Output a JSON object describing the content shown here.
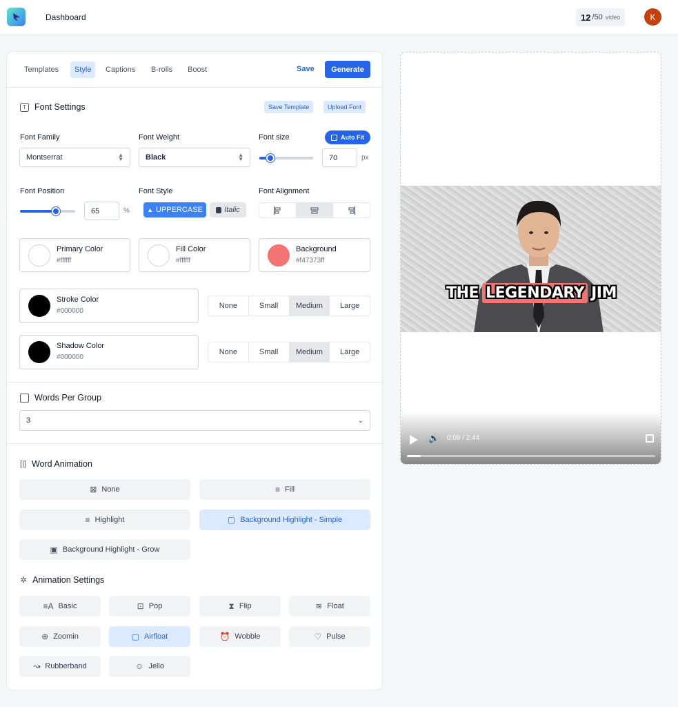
{
  "app": {
    "page_title": "Dashboard",
    "credits_used": "12",
    "credits_total": "/50",
    "credits_unit": "video",
    "avatar_initial": "K"
  },
  "tabs": [
    "Templates",
    "Style",
    "Captions",
    "B-rolls",
    "Boost"
  ],
  "active_tab": "Style",
  "actions": {
    "save": "Save",
    "generate": "Generate"
  },
  "font_settings": {
    "title": "Font Settings",
    "save_template": "Save Template",
    "upload_font": "Upload Font",
    "family_label": "Font Family",
    "family_value": "Montserrat",
    "weight_label": "Font Weight",
    "weight_value": "Black",
    "size_label": "Font size",
    "auto_fit": "Auto Fit",
    "size_value": "70",
    "size_unit": "px",
    "size_slider_fraction": 0.2,
    "position_label": "Font Position",
    "position_value": "65",
    "position_unit": "%",
    "position_slider_fraction": 0.65,
    "style_label": "Font Style",
    "uppercase": "UPPERCASE",
    "italic": "Italic",
    "alignment_label": "Font Alignment",
    "alignment_selected": "center"
  },
  "colors": {
    "primary": {
      "name": "Primary Color",
      "hex": "#ffffff"
    },
    "fill": {
      "name": "Fill Color",
      "hex": "#ffffff"
    },
    "background": {
      "name": "Background",
      "hex": "#f47373ff"
    },
    "stroke": {
      "name": "Stroke Color",
      "hex": "#000000"
    },
    "shadow": {
      "name": "Shadow Color",
      "hex": "#000000"
    }
  },
  "size_options": [
    "None",
    "Small",
    "Medium",
    "Large"
  ],
  "stroke_size_selected": "Medium",
  "shadow_size_selected": "Medium",
  "words_per_group": {
    "title": "Words Per Group",
    "value": "3"
  },
  "word_animation": {
    "title": "Word Animation",
    "options": [
      "None",
      "Fill",
      "Highlight",
      "Background Highlight - Simple",
      "Background Highlight - Grow"
    ],
    "selected": "Background Highlight - Simple"
  },
  "animation_settings": {
    "title": "Animation Settings",
    "options": [
      "Basic",
      "Pop",
      "Flip",
      "Float",
      "Zoomin",
      "Airfloat",
      "Wobble",
      "Pulse",
      "Rubberband",
      "Jello"
    ],
    "selected": "Airfloat"
  },
  "preview": {
    "caption_words": [
      "THE",
      "LEGENDARY",
      "JIM"
    ],
    "highlight_word_index": 1,
    "time": "0:09 / 2:44",
    "progress_fraction": 0.055
  },
  "accent_color": "#2563eb",
  "highlight_color": "#f47373"
}
